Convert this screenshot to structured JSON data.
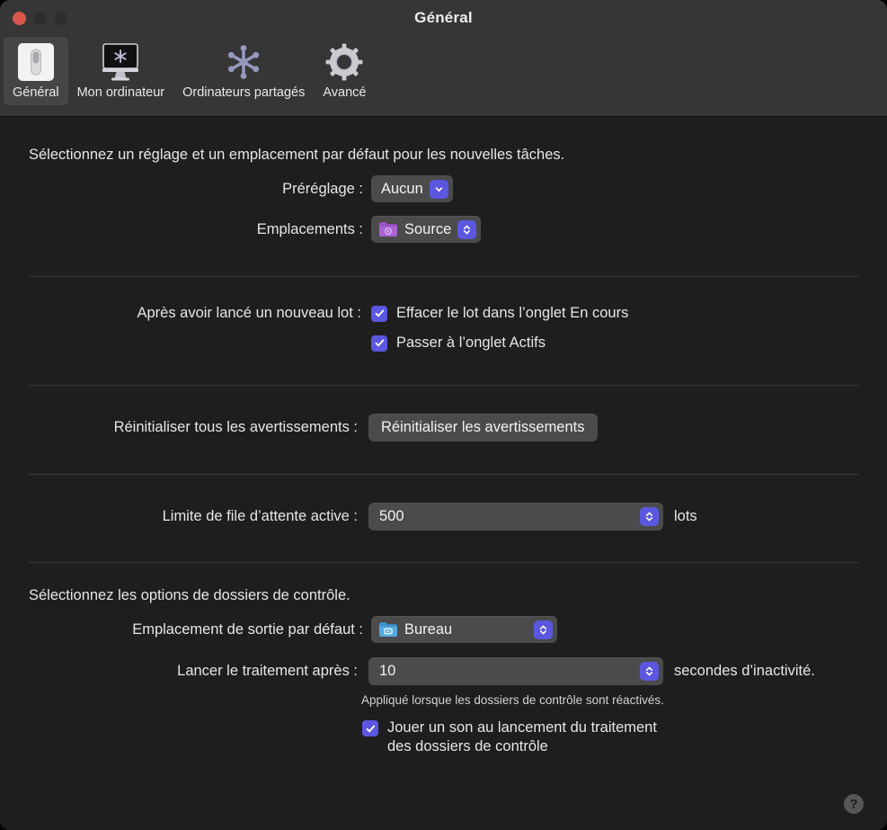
{
  "window": {
    "title": "Général",
    "traffic_lights": [
      "close",
      "minimize",
      "zoom"
    ]
  },
  "toolbar": {
    "tabs": [
      {
        "label": "Général",
        "icon": "switch-icon",
        "selected": true
      },
      {
        "label": "Mon ordinateur",
        "icon": "display-icon",
        "selected": false
      },
      {
        "label": "Ordinateurs partagés",
        "icon": "shared-computers-icon",
        "selected": false
      },
      {
        "label": "Avancé",
        "icon": "gear-icon",
        "selected": false
      }
    ]
  },
  "sections": {
    "defaults": {
      "intro": "Sélectionnez un réglage et un emplacement par défaut pour les nouvelles tâches.",
      "preset": {
        "label": "Préréglage :",
        "value": "Aucun",
        "control": "pull-down"
      },
      "locations": {
        "label": "Emplacements :",
        "value": "Source",
        "icon": "purple-folder-icon",
        "control": "pop-up"
      }
    },
    "after_batch": {
      "label": "Après avoir lancé un nouveau lot :",
      "options": [
        {
          "label": "Effacer le lot dans l’onglet En cours",
          "checked": true
        },
        {
          "label": "Passer à l’onglet Actifs",
          "checked": true
        }
      ]
    },
    "warnings": {
      "label": "Réinitialiser tous les avertissements :",
      "button": "Réinitialiser les avertissements"
    },
    "queue": {
      "label": "Limite de file d’attente active :",
      "value": "500",
      "unit": "lots"
    },
    "watch_folders": {
      "intro": "Sélectionnez les options de dossiers de contrôle.",
      "output_location": {
        "label": "Emplacement de sortie par défaut :",
        "value": "Bureau",
        "icon": "blue-folder-icon"
      },
      "delay": {
        "label": "Lancer le traitement après :",
        "value": "10",
        "unit": "secondes d’inactivité.",
        "hint": "Appliqué lorsque les dossiers de contrôle sont réactivés."
      },
      "sound": {
        "label_line1": "Jouer un son au lancement du traitement",
        "label_line2": "des dossiers de contrôle",
        "checked": true
      }
    }
  },
  "help": {
    "glyph": "?"
  },
  "colors": {
    "accent": "#5b57e0",
    "toolbar_bg": "#363636",
    "content_bg": "#1e1e1e",
    "control_bg": "#4b4b4b",
    "close_button": "#d6574c"
  }
}
